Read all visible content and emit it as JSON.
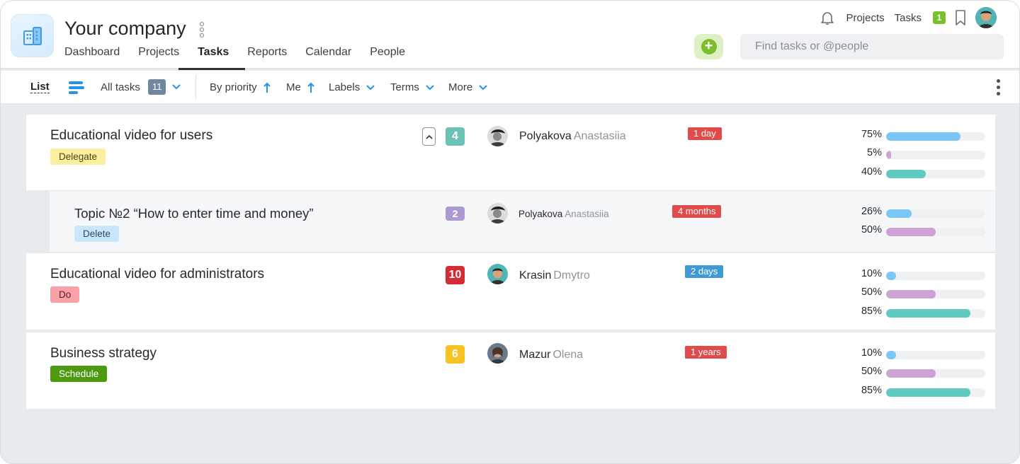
{
  "header": {
    "company": "Your company",
    "nav": [
      "Dashboard",
      "Projects",
      "Tasks",
      "Reports",
      "Calendar",
      "People"
    ],
    "active_tab": "Tasks",
    "search_placeholder": "Find tasks or @people",
    "top_links": {
      "projects": "Projects",
      "tasks": "Tasks",
      "tasks_badge": "1"
    }
  },
  "toolbar": {
    "list": "List",
    "all_tasks": "All tasks",
    "count": "11",
    "by_priority": "By priority",
    "me": "Me",
    "labels": "Labels",
    "terms": "Terms",
    "more": "More"
  },
  "tasks": [
    {
      "title": "Educational video for users",
      "label": "Delegate",
      "label_bg": "#fdef9e",
      "label_fg": "#4a4418",
      "count": "4",
      "count_color": "#6cc3b5",
      "first": "Polyakova",
      "last": "Anastasiia",
      "due": "1 day",
      "due_color": "#e04b4b",
      "progress": [
        75,
        5,
        40
      ],
      "progress_labels": [
        "75%",
        "5%",
        "40%"
      ]
    },
    {
      "title": "Topic №2 “How to enter time and money”",
      "label": "Delete",
      "label_bg": "#c9e6fb",
      "label_fg": "#2d4a60",
      "count": "2",
      "count_color": "#ab9ad0",
      "first": "Polyakova",
      "last": "Anastasiia",
      "due": "4 months",
      "due_color": "#e04b4b",
      "progress": [
        26,
        50
      ],
      "progress_labels": [
        "26%",
        "50%"
      ]
    },
    {
      "title": "Educational video for administrators",
      "label": "Do",
      "label_bg": "#f9a0a8",
      "label_fg": "#5a1d22",
      "count": "10",
      "count_color": "#d42b35",
      "first": "Krasin",
      "last": "Dmytro",
      "due": "2 days",
      "due_color": "#3e9ad3",
      "progress": [
        10,
        50,
        85
      ],
      "progress_labels": [
        "10%",
        "50%",
        "85%"
      ]
    },
    {
      "title": "Business strategy",
      "label": "Schedule",
      "label_bg": "#4d9a10",
      "label_fg": "#ffffff",
      "count": "6",
      "count_color": "#f7c324",
      "first": "Mazur",
      "last": "Olena",
      "due": "1 years",
      "due_color": "#e04b4b",
      "progress": [
        10,
        50,
        85
      ],
      "progress_labels": [
        "10%",
        "50%",
        "85%"
      ]
    }
  ],
  "progress_colors": [
    "#7cc6f7",
    "#cfa1d6",
    "#5ecac0"
  ]
}
